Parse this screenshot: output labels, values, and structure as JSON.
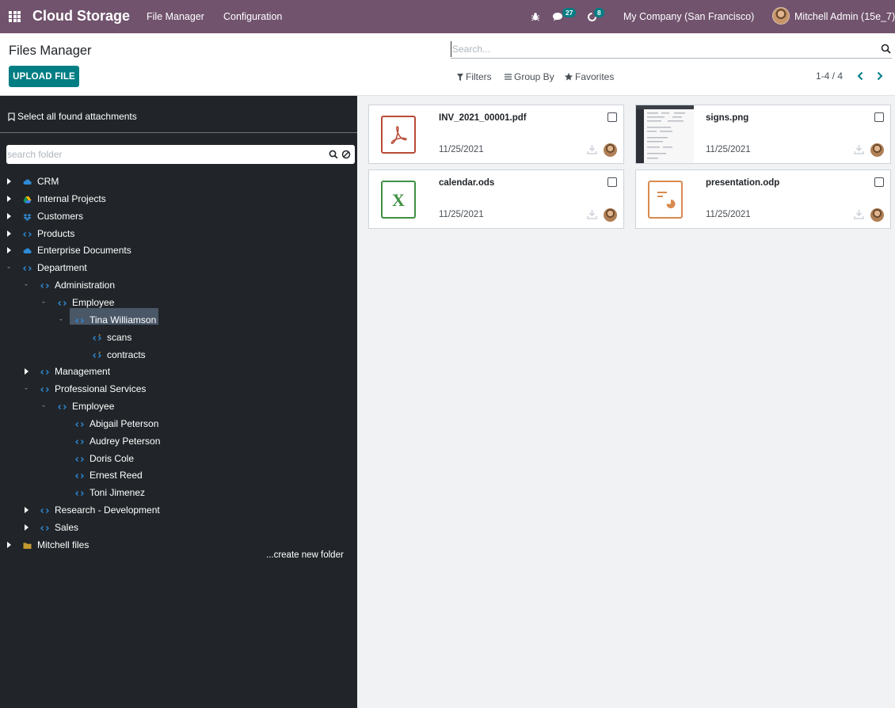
{
  "navbar": {
    "app_title": "Cloud Storage",
    "menus": [
      "File Manager",
      "Configuration"
    ],
    "messages_count": "27",
    "activities_count": "8",
    "company": "My Company (San Francisco)",
    "user": "Mitchell Admin (15e_7)",
    "color": "#71536e"
  },
  "control_panel": {
    "title": "Files Manager",
    "upload_label": "UPLOAD FILE",
    "search_placeholder": "Search...",
    "filters_label": "Filters",
    "group_by_label": "Group By",
    "favorites_label": "Favorites",
    "pager_value": "1-4 / 4",
    "accent": "#017e84"
  },
  "sidebar": {
    "select_all_label": "Select all found attachments",
    "folder_search_placeholder": "search folder",
    "create_folder_label": "...create new folder",
    "tree": [
      {
        "label": "CRM",
        "icon": "cloud-icon"
      },
      {
        "label": "Internal Projects",
        "icon": "google-drive-icon"
      },
      {
        "label": "Customers",
        "icon": "dropbox-icon"
      },
      {
        "label": "Products",
        "icon": "code-icon"
      },
      {
        "label": "Enterprise Documents",
        "icon": "cloud-icon"
      },
      {
        "label": "Department",
        "icon": "code-icon"
      },
      {
        "label": "Administration",
        "icon": "code-icon"
      },
      {
        "label": "Employee",
        "icon": "code-icon"
      },
      {
        "label": "Tina Williamson",
        "icon": "code-icon",
        "selected": true
      },
      {
        "label": "scans",
        "icon": "code-icon"
      },
      {
        "label": "contracts",
        "icon": "code-icon"
      },
      {
        "label": "Management",
        "icon": "code-icon"
      },
      {
        "label": "Professional Services",
        "icon": "code-icon"
      },
      {
        "label": "Employee",
        "icon": "code-icon"
      },
      {
        "label": "Abigail Peterson",
        "icon": "code-icon"
      },
      {
        "label": "Audrey Peterson",
        "icon": "code-icon"
      },
      {
        "label": "Doris Cole",
        "icon": "code-icon"
      },
      {
        "label": "Ernest Reed",
        "icon": "code-icon"
      },
      {
        "label": "Toni Jimenez",
        "icon": "code-icon"
      },
      {
        "label": "Research - Development",
        "icon": "code-icon"
      },
      {
        "label": "Sales",
        "icon": "code-icon"
      },
      {
        "label": "Mitchell files",
        "icon": "folder-icon"
      }
    ]
  },
  "files": [
    {
      "name": "INV_2021_00001.pdf",
      "date": "11/25/2021",
      "type": "pdf",
      "color": "#b94a38"
    },
    {
      "name": "signs.png",
      "date": "11/25/2021",
      "type": "image"
    },
    {
      "name": "calendar.ods",
      "date": "11/25/2021",
      "type": "spreadsheet",
      "color": "#3f9142"
    },
    {
      "name": "presentation.odp",
      "date": "11/25/2021",
      "type": "presentation",
      "color": "#d88a4e"
    }
  ]
}
